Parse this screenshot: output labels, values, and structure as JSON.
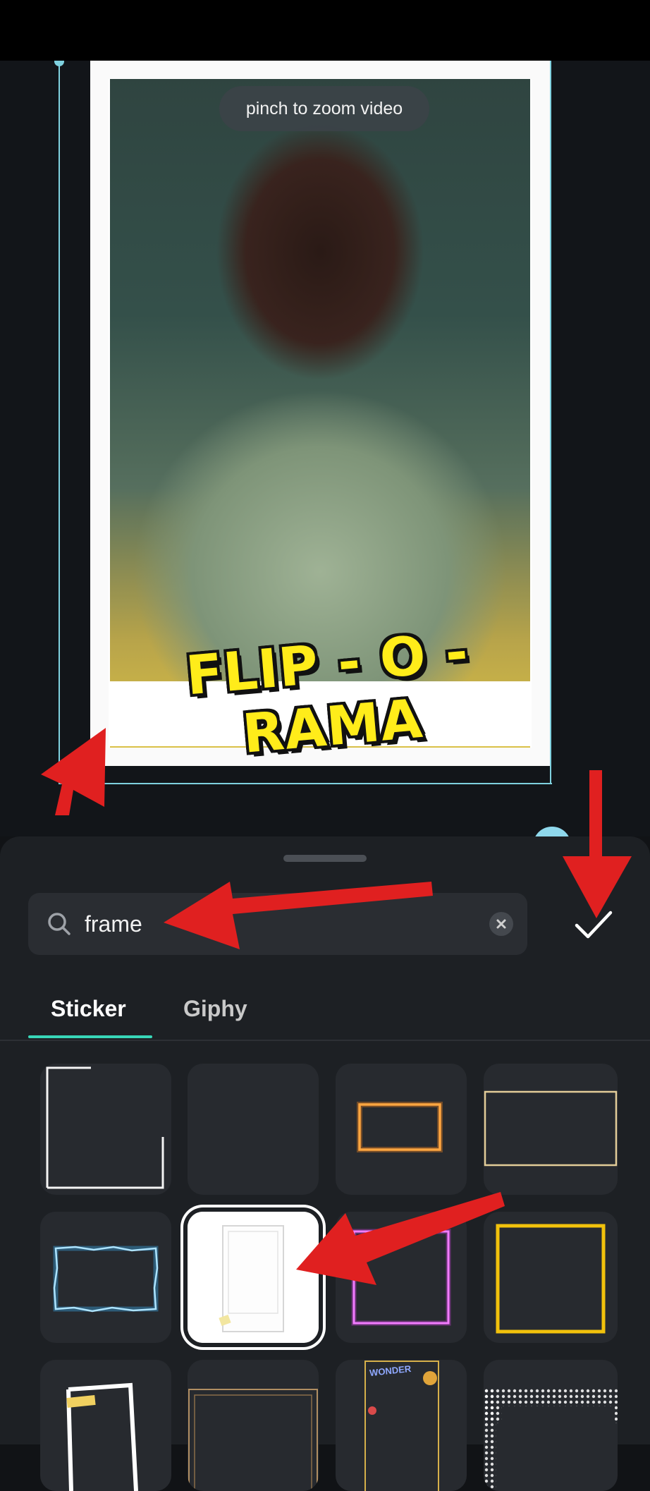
{
  "video_preview": {
    "hint": "pinch to zoom video",
    "title_sticker_text": "FLIP - O - RAMA"
  },
  "search": {
    "value": "frame",
    "placeholder": ""
  },
  "tabs": [
    {
      "label": "Sticker",
      "active": true
    },
    {
      "label": "Giphy",
      "active": false
    }
  ],
  "stickers": [
    {
      "name": "white-corner-frame"
    },
    {
      "name": "blank-frame"
    },
    {
      "name": "orange-glow-rectangle-frame"
    },
    {
      "name": "beige-thin-rectangle-frame"
    },
    {
      "name": "blue-electric-frame"
    },
    {
      "name": "polaroid-white-frame",
      "selected": true
    },
    {
      "name": "magenta-neon-frame"
    },
    {
      "name": "yellow-square-frame"
    },
    {
      "name": "white-tilted-frame"
    },
    {
      "name": "gold-border-frame"
    },
    {
      "name": "wonder-decorated-frame",
      "text": "WONDER"
    },
    {
      "name": "halftone-pattern-frame"
    }
  ],
  "colors": {
    "accent_tab": "#38d7b8",
    "guide": "#7fd1df",
    "annotation_arrow": "#e02020",
    "title_yellow": "#ffec1a"
  }
}
